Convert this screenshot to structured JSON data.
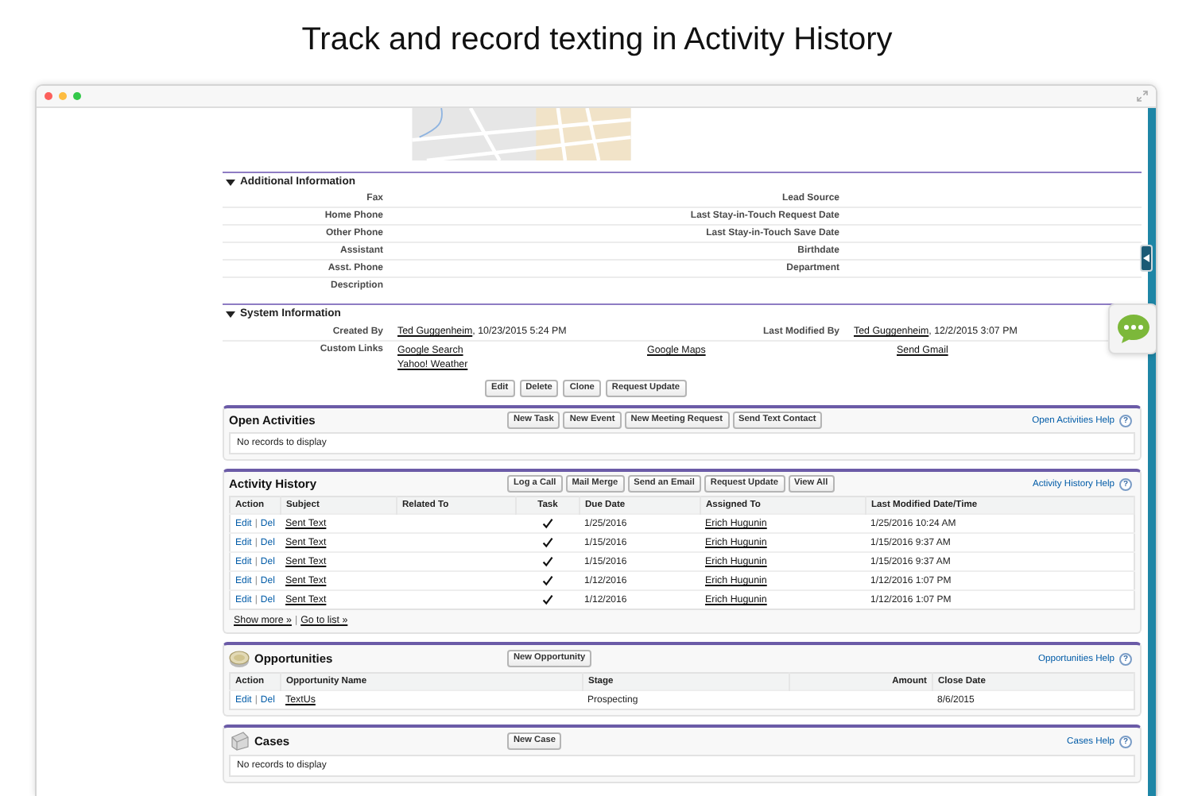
{
  "page_title": "Track and record texting in Activity History",
  "additional_information": {
    "title": "Additional Information",
    "expanded": true,
    "rows": [
      {
        "left": "Fax",
        "right": "Lead Source"
      },
      {
        "left": "Home Phone",
        "right": "Last Stay-in-Touch Request Date"
      },
      {
        "left": "Other Phone",
        "right": "Last Stay-in-Touch Save Date"
      },
      {
        "left": "Assistant",
        "right": "Birthdate"
      },
      {
        "left": "Asst. Phone",
        "right": "Department"
      },
      {
        "left": "Description"
      }
    ]
  },
  "system_information": {
    "title": "System Information",
    "expanded": true,
    "created_by": {
      "label": "Created By",
      "user": "Ted Guggenheim",
      "date_text": ", 10/23/2015 5:24 PM"
    },
    "last_modified_by": {
      "label": "Last Modified By",
      "user": "Ted Guggenheim",
      "date_text": ", 12/2/2015 3:07 PM"
    },
    "custom_links": {
      "label": "Custom Links",
      "links": [
        "Google Search",
        "Google Maps",
        "Send Gmail",
        "Yahoo! Weather"
      ]
    }
  },
  "detail_buttons": [
    "Edit",
    "Delete",
    "Clone",
    "Request Update"
  ],
  "related_lists": [
    {
      "kind": "empty",
      "title": "Open Activities",
      "buttons": [
        "New Task",
        "New Event",
        "New Meeting Request",
        "Send Text Contact"
      ],
      "help": "Open Activities Help",
      "help_icon": "?",
      "empty_text": "No records to display"
    },
    {
      "kind": "table",
      "title": "Activity History",
      "buttons": [
        "Log a Call",
        "Mail Merge",
        "Send an Email",
        "Request Update",
        "View All"
      ],
      "help": "Activity History Help",
      "help_icon": "?",
      "columns": [
        {
          "label": "Action",
          "kind": "actions"
        },
        {
          "label": "Subject",
          "kind": "link"
        },
        {
          "label": "Related To",
          "kind": "text"
        },
        {
          "label": "Task",
          "kind": "check"
        },
        {
          "label": "Due Date",
          "kind": "text"
        },
        {
          "label": "Assigned To",
          "kind": "link"
        },
        {
          "label": "Last Modified Date/Time",
          "kind": "text"
        }
      ],
      "rows": [
        {
          "cells": [
            {
              "links": [
                "Edit",
                "Del"
              ],
              "separator": "|"
            },
            {
              "text": "Sent Text"
            },
            {},
            {
              "checked": true
            },
            {
              "text": "1/25/2016"
            },
            {
              "text": "Erich Hugunin"
            },
            {
              "text": "1/25/2016 10:24 AM"
            }
          ]
        },
        {
          "cells": [
            {
              "links": [
                "Edit",
                "Del"
              ],
              "separator": "|"
            },
            {
              "text": "Sent Text"
            },
            {},
            {
              "checked": true
            },
            {
              "text": "1/15/2016"
            },
            {
              "text": "Erich Hugunin"
            },
            {
              "text": "1/15/2016 9:37 AM"
            }
          ]
        },
        {
          "cells": [
            {
              "links": [
                "Edit",
                "Del"
              ],
              "separator": "|"
            },
            {
              "text": "Sent Text"
            },
            {},
            {
              "checked": true
            },
            {
              "text": "1/15/2016"
            },
            {
              "text": "Erich Hugunin"
            },
            {
              "text": "1/15/2016 9:37 AM"
            }
          ]
        },
        {
          "cells": [
            {
              "links": [
                "Edit",
                "Del"
              ],
              "separator": "|"
            },
            {
              "text": "Sent Text"
            },
            {},
            {
              "checked": true
            },
            {
              "text": "1/12/2016"
            },
            {
              "text": "Erich Hugunin"
            },
            {
              "text": "1/12/2016 1:07 PM"
            }
          ]
        },
        {
          "cells": [
            {
              "links": [
                "Edit",
                "Del"
              ],
              "separator": "|"
            },
            {
              "text": "Sent Text"
            },
            {},
            {
              "checked": true
            },
            {
              "text": "1/12/2016"
            },
            {
              "text": "Erich Hugunin"
            },
            {
              "text": "1/12/2016 1:07 PM"
            }
          ]
        }
      ],
      "footer_links": [
        "Show more »",
        "Go to list »"
      ],
      "footer_separator": "|"
    },
    {
      "kind": "table",
      "title": "Opportunities",
      "buttons": [
        "New Opportunity"
      ],
      "help": "Opportunities Help",
      "help_icon": "?",
      "columns": [
        {
          "label": "Action",
          "kind": "actions"
        },
        {
          "label": "Opportunity Name",
          "kind": "link"
        },
        {
          "label": "Stage",
          "kind": "text"
        },
        {
          "label": "Amount",
          "kind": "number"
        },
        {
          "label": "Close Date",
          "kind": "text"
        }
      ],
      "rows": [
        {
          "cells": [
            {
              "links": [
                "Edit",
                "Del"
              ],
              "separator": "|"
            },
            {
              "text": "TextUs"
            },
            {
              "text": "Prospecting"
            },
            {},
            {
              "text": "8/6/2015"
            }
          ]
        }
      ]
    },
    {
      "kind": "empty",
      "title": "Cases",
      "buttons": [
        "New Case"
      ],
      "help": "Cases Help",
      "help_icon": "?",
      "empty_text": "No records to display"
    }
  ]
}
